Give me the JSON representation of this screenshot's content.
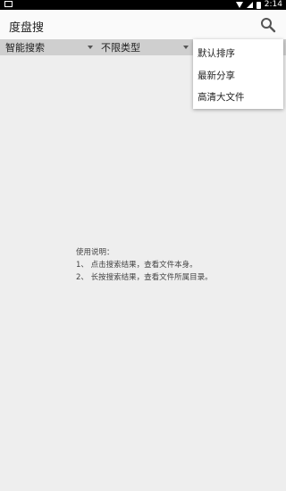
{
  "status_bar": {
    "time": "2:14",
    "icons": [
      "notification-icon",
      "wifi-icon",
      "signal-icon",
      "battery-icon"
    ]
  },
  "app_bar": {
    "title": "度盘搜",
    "search_icon": "search-icon"
  },
  "filters": [
    {
      "label": "智能搜索"
    },
    {
      "label": "不限类型"
    }
  ],
  "sort_menu": {
    "items": [
      "默认排序",
      "最新分享",
      "高清大文件"
    ]
  },
  "instructions": {
    "heading": "使用说明：",
    "lines": [
      "1、 点击搜索结果，查看文件本身。",
      "2、 长按搜索结果，查看文件所属目录。"
    ]
  }
}
